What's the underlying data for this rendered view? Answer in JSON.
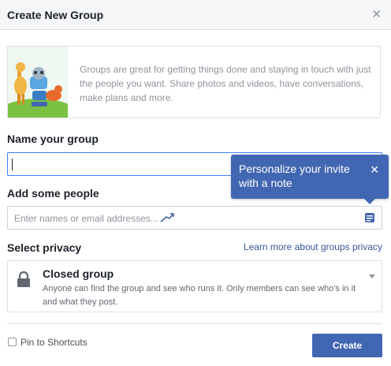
{
  "dialog": {
    "title": "Create New Group"
  },
  "intro": {
    "text": "Groups are great for getting things done and staying in touch with just the people you want. Share photos and videos, have conversations, make plans and more."
  },
  "name_section": {
    "label": "Name your group",
    "value": ""
  },
  "tooltip": {
    "text": "Personalize your invite with a note"
  },
  "people_section": {
    "label": "Add some people",
    "placeholder": "Enter names or email addresses..."
  },
  "privacy_section": {
    "label": "Select privacy",
    "learn_more_link": "Learn more about groups privacy",
    "selected_option": {
      "title": "Closed group",
      "description": "Anyone can find the group and see who runs it. Only members can see who's in it and what they post."
    }
  },
  "footer": {
    "pin_label": "Pin to Shortcuts",
    "pin_checked": false,
    "create_label": "Create"
  },
  "colors": {
    "accent": "#4267b2",
    "focus_border": "#4080ff",
    "link": "#365899",
    "muted_text": "#90949c"
  },
  "icons": {
    "close": "close-icon",
    "lock": "lock-icon",
    "note": "note-icon",
    "cursor": "cursor-icon",
    "dropdown": "chevron-down-icon"
  }
}
